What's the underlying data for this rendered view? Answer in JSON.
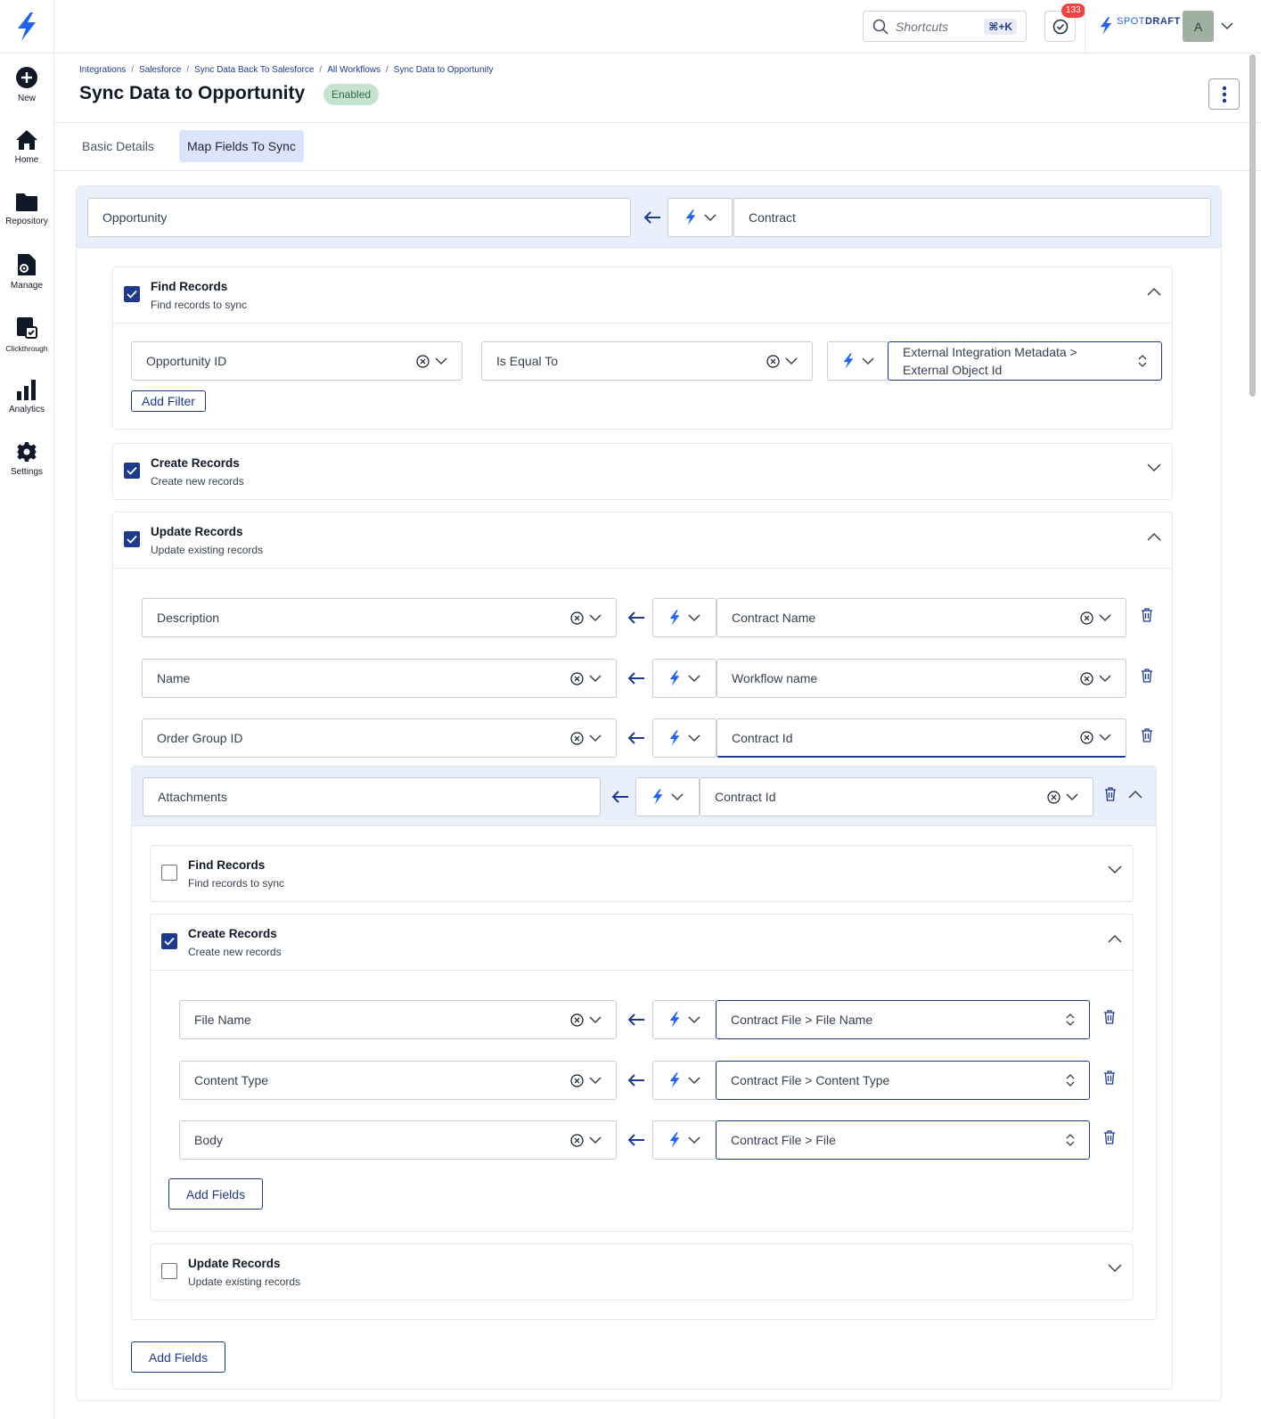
{
  "topbar": {
    "search_label": "Shortcuts",
    "shortcut_key": "⌘+K",
    "notifications_count": "133",
    "brand_prefix": "SPOT",
    "brand_suffix": "DRAFT",
    "avatar_initial": "A"
  },
  "sidebar": {
    "items": [
      {
        "label": "New",
        "icon": "plus-circle-icon"
      },
      {
        "label": "Home",
        "icon": "home-icon"
      },
      {
        "label": "Repository",
        "icon": "folder-icon"
      },
      {
        "label": "Manage",
        "icon": "manage-doc-icon"
      },
      {
        "label": "Clickthrough",
        "icon": "clickthrough-icon"
      },
      {
        "label": "Analytics",
        "icon": "bar-chart-icon"
      },
      {
        "label": "Settings",
        "icon": "gear-icon"
      }
    ]
  },
  "header": {
    "breadcrumb": [
      "Integrations",
      "Salesforce",
      "Sync Data Back To Salesforce",
      "All Workflows",
      "Sync Data to Opportunity"
    ],
    "title": "Sync Data to Opportunity",
    "status": "Enabled"
  },
  "tabs": [
    "Basic Details",
    "Map Fields To Sync"
  ],
  "mapping": {
    "target_object": "Opportunity",
    "source_object": "Contract",
    "find_records": {
      "title": "Find Records",
      "subtitle": "Find records to sync",
      "checked": true,
      "filter": {
        "field": "Opportunity ID",
        "operator": "Is Equal To",
        "value_line1": "External Integration Metadata >",
        "value_line2": "External Object Id"
      },
      "add_filter_label": "Add Filter"
    },
    "create_records": {
      "title": "Create Records",
      "subtitle": "Create new records",
      "checked": true
    },
    "update_records": {
      "title": "Update Records",
      "subtitle": "Update existing records",
      "checked": true,
      "rows": [
        {
          "target": "Description",
          "source": "Contract Name"
        },
        {
          "target": "Name",
          "source": "Workflow name"
        },
        {
          "target": "Order Group ID",
          "source": "Contract Id"
        }
      ],
      "nested": {
        "target": "Attachments",
        "source": "Contract Id",
        "find_records": {
          "title": "Find Records",
          "subtitle": "Find records to sync",
          "checked": false
        },
        "create_records": {
          "title": "Create Records",
          "subtitle": "Create new records",
          "checked": true,
          "rows": [
            {
              "target": "File Name",
              "source": "Contract File > File Name"
            },
            {
              "target": "Content Type",
              "source": "Contract File > Content Type"
            },
            {
              "target": "Body",
              "source": "Contract File > File"
            }
          ],
          "add_fields_label": "Add Fields"
        },
        "update_records": {
          "title": "Update Records",
          "subtitle": "Update existing records",
          "checked": false
        }
      },
      "add_fields_label": "Add Fields"
    }
  },
  "colors": {
    "accent": "#1e3a8a",
    "brand_blue": "#2563eb",
    "badge_bg": "#c6e3cf",
    "notification": "#ef4444",
    "object_row_bg": "#e9effb"
  }
}
